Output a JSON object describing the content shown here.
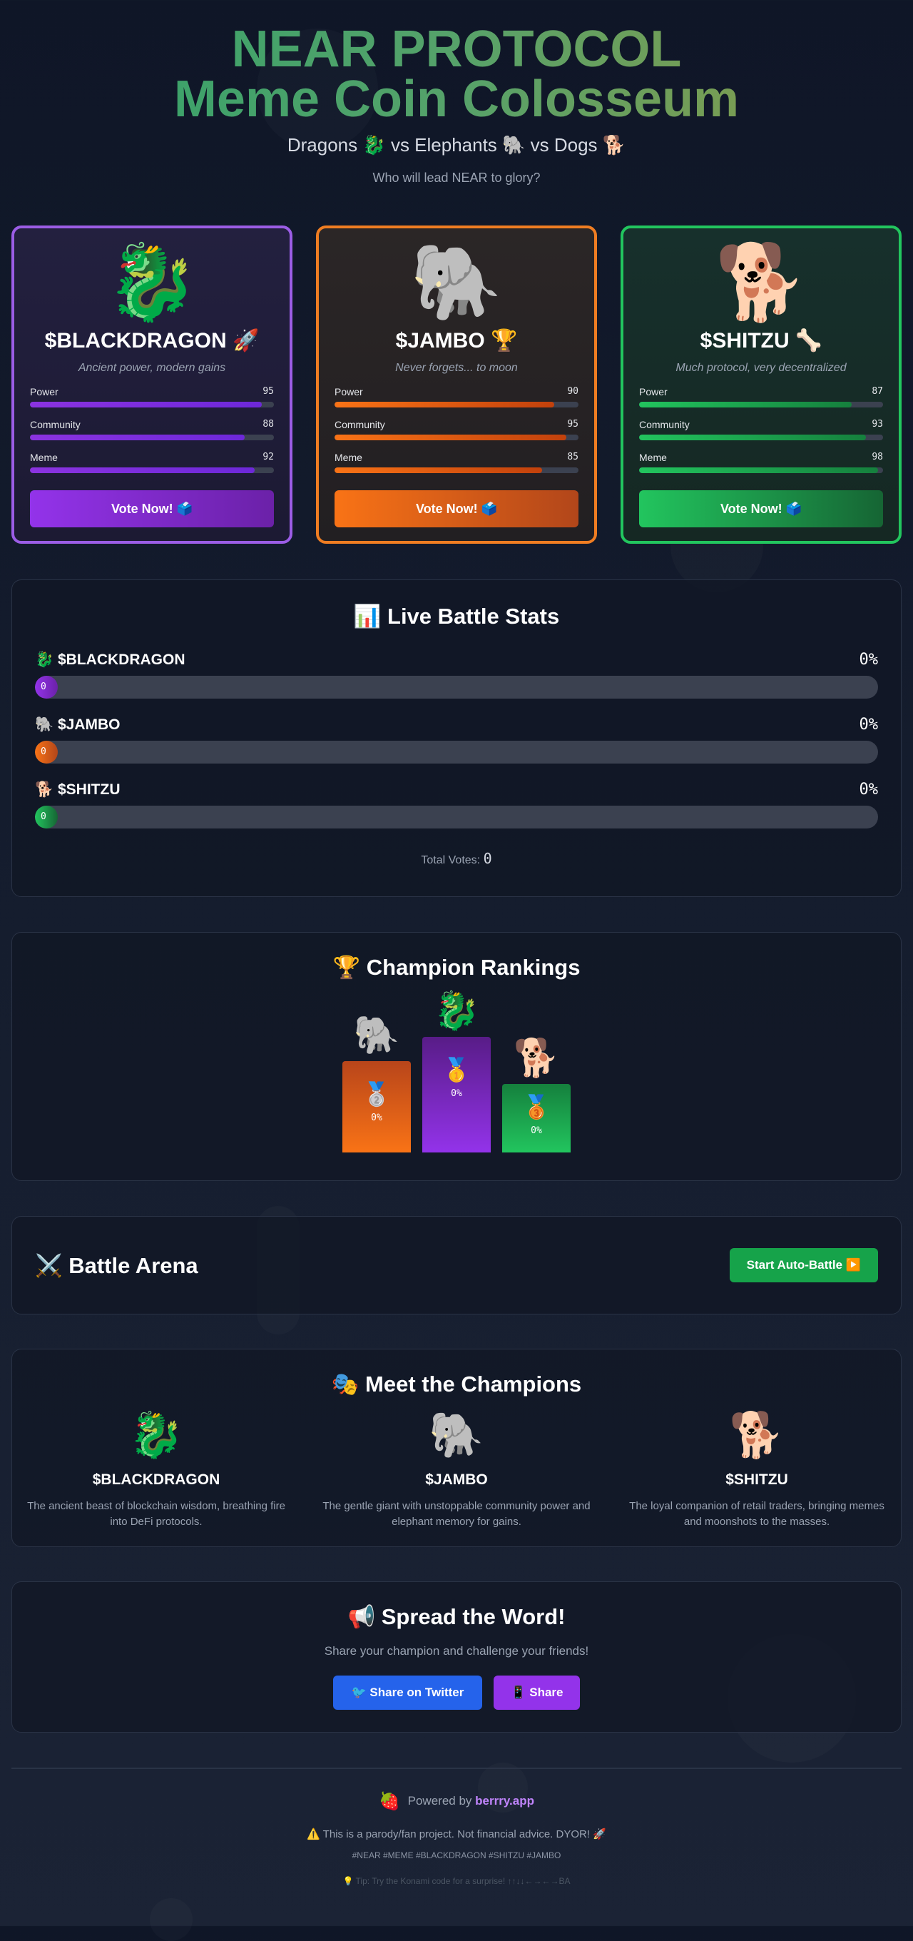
{
  "header": {
    "title_line1": "NEAR PROTOCOL",
    "title_line2": "Meme Coin Colosseum",
    "subtitle": "Dragons 🐉 vs Elephants 🐘 vs Dogs 🐕",
    "tagline": "Who will lead NEAR to glory?"
  },
  "coins": [
    {
      "emoji": "🐉",
      "name": "$BLACKDRAGON 🚀",
      "motto": "Ancient power, modern gains",
      "stats": [
        {
          "label": "Power",
          "value": 95
        },
        {
          "label": "Community",
          "value": 88
        },
        {
          "label": "Meme",
          "value": 92
        }
      ],
      "vote_label": "Vote Now! 🗳️",
      "color": "#9b5de5"
    },
    {
      "emoji": "🐘",
      "name": "$JAMBO 🏆",
      "motto": "Never forgets... to moon",
      "stats": [
        {
          "label": "Power",
          "value": 90
        },
        {
          "label": "Community",
          "value": 95
        },
        {
          "label": "Meme",
          "value": 85
        }
      ],
      "vote_label": "Vote Now! 🗳️",
      "color": "#ef7d22"
    },
    {
      "emoji": "🐕",
      "name": "$SHITZU 🦴",
      "motto": "Much protocol, very decentralized",
      "stats": [
        {
          "label": "Power",
          "value": 87
        },
        {
          "label": "Community",
          "value": 93
        },
        {
          "label": "Meme",
          "value": 98
        }
      ],
      "vote_label": "Vote Now! 🗳️",
      "color": "#22c55e"
    }
  ],
  "live_stats": {
    "title": "📊 Live Battle Stats",
    "rows": [
      {
        "name": "🐉 $BLACKDRAGON",
        "percent": "0%",
        "bar_label": "0",
        "share": 0
      },
      {
        "name": "🐘 $JAMBO",
        "percent": "0%",
        "bar_label": "0",
        "share": 0
      },
      {
        "name": "🐕 $SHITZU",
        "percent": "0%",
        "bar_label": "0",
        "share": 0
      }
    ],
    "total_label": "Total Votes:",
    "total_value": "0"
  },
  "rankings": {
    "title": "🏆 Champion Rankings",
    "podium": [
      {
        "emoji": "🐘",
        "medal": "🥈",
        "percent": "0%"
      },
      {
        "emoji": "🐉",
        "medal": "🥇",
        "percent": "0%"
      },
      {
        "emoji": "🐕",
        "medal": "🥉",
        "percent": "0%"
      }
    ]
  },
  "arena": {
    "title": "⚔️ Battle Arena",
    "auto_battle_label": "Start Auto-Battle ▶️"
  },
  "meet": {
    "title": "🎭 Meet the Champions",
    "champions": [
      {
        "emoji": "🐉",
        "name": "$BLACKDRAGON",
        "desc": "The ancient beast of blockchain wisdom, breathing fire into DeFi protocols."
      },
      {
        "emoji": "🐘",
        "name": "$JAMBO",
        "desc": "The gentle giant with unstoppable community power and elephant memory for gains."
      },
      {
        "emoji": "🐕",
        "name": "$SHITZU",
        "desc": "The loyal companion of retail traders, bringing memes and moonshots to the masses."
      }
    ]
  },
  "share": {
    "title": "📢 Spread the Word!",
    "desc": "Share your champion and challenge your friends!",
    "twitter_label": "🐦 Share on Twitter",
    "share_label": "📱 Share"
  },
  "footer": {
    "straw_emoji": "🍓",
    "powered_prefix": "Powered by",
    "brand": "berrry.app",
    "disclaimer": "⚠️ This is a parody/fan project. Not financial advice. DYOR! 🚀",
    "hashtags": "#NEAR #MEME #BLACKDRAGON #SHITZU #JAMBO",
    "tip": "💡 Tip: Try the Konami code for a surprise! ↑↑↓↓←→←→BA"
  }
}
